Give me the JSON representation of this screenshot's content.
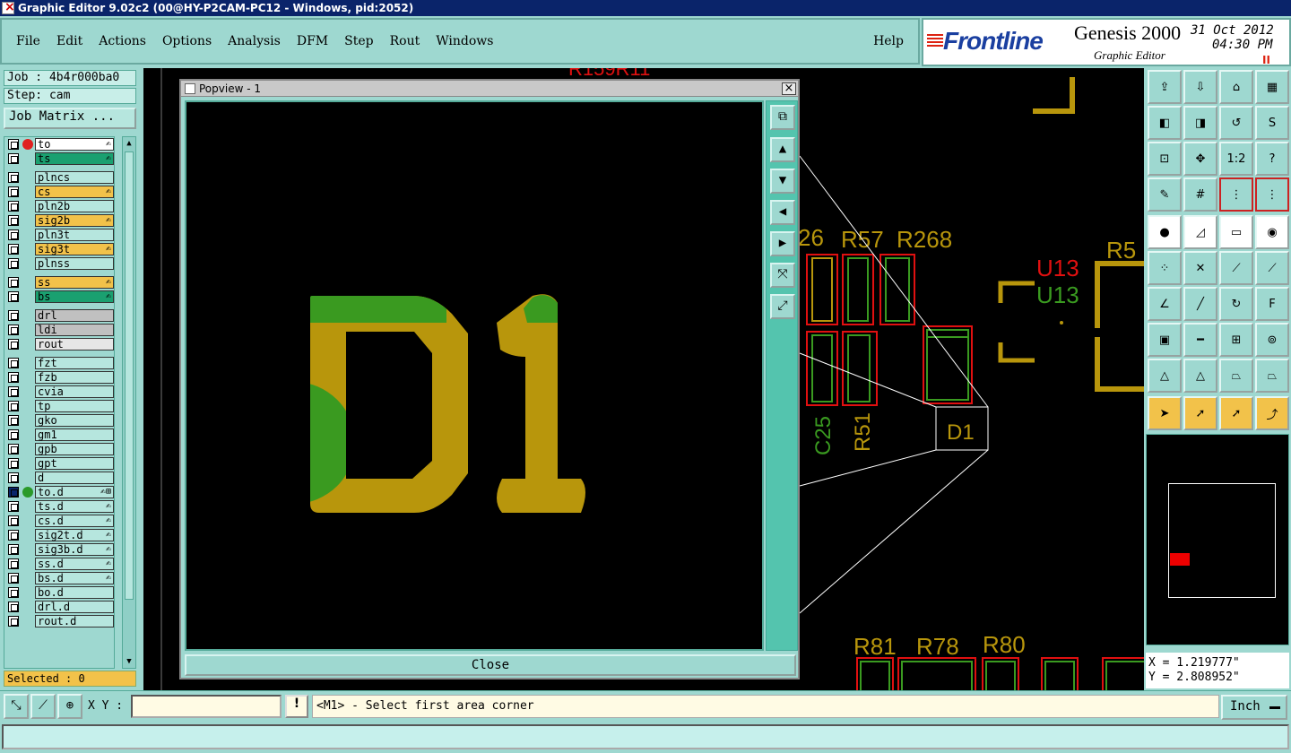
{
  "window": {
    "title": "Graphic Editor 9.02c2 (00@HY-P2CAM-PC12 - Windows, pid:2052)"
  },
  "menu": [
    "File",
    "Edit",
    "Actions",
    "Options",
    "Analysis",
    "DFM",
    "Step",
    "Rout",
    "Windows"
  ],
  "help": "Help",
  "logo": {
    "brand": "Frontline",
    "product": "Genesis 2000",
    "subtitle": "Graphic Editor",
    "date": "31 Oct 2012",
    "time": "04:30 PM",
    "pause": "II"
  },
  "job": {
    "job": "Job : 4b4r000ba0",
    "step": "Step: cam",
    "matrix": "Job Matrix ..."
  },
  "layers": [
    {
      "name": "to",
      "color": "#ffffff",
      "dot": "#e02020",
      "mark": "✍",
      "group": 0
    },
    {
      "name": "ts",
      "color": "#1aa070",
      "mark": "✍",
      "group": 0
    },
    {
      "name": "plncs",
      "color": "#b6e6de",
      "group": 1
    },
    {
      "name": "cs",
      "color": "#f2c24a",
      "mark": "✍",
      "group": 1
    },
    {
      "name": "pln2b",
      "color": "#b6e6de",
      "group": 1
    },
    {
      "name": "sig2b",
      "color": "#f2c24a",
      "mark": "✍",
      "group": 1
    },
    {
      "name": "pln3t",
      "color": "#b6e6de",
      "group": 1
    },
    {
      "name": "sig3t",
      "color": "#f2c24a",
      "mark": "✍",
      "group": 1
    },
    {
      "name": "plnss",
      "color": "#b6e6de",
      "group": 1
    },
    {
      "name": "ss",
      "color": "#f2c24a",
      "mark": "✍",
      "group": 2
    },
    {
      "name": "bs",
      "color": "#1aa070",
      "mark": "✍",
      "group": 2
    },
    {
      "name": "drl",
      "color": "#c0c0c0",
      "group": 3
    },
    {
      "name": "ldi",
      "color": "#c0c0c0",
      "group": 3
    },
    {
      "name": "rout",
      "color": "#e6e6e6",
      "group": 3
    },
    {
      "name": "fzt",
      "color": "#b6e6de",
      "group": 4
    },
    {
      "name": "fzb",
      "color": "#b6e6de",
      "group": 4
    },
    {
      "name": "cvia",
      "color": "#b6e6de",
      "group": 4
    },
    {
      "name": "tp",
      "color": "#b6e6de",
      "group": 4
    },
    {
      "name": "gko",
      "color": "#b6e6de",
      "group": 4
    },
    {
      "name": "gm1",
      "color": "#b6e6de",
      "group": 4
    },
    {
      "name": "gpb",
      "color": "#b6e6de",
      "group": 4
    },
    {
      "name": "gpt",
      "color": "#b6e6de",
      "group": 4
    },
    {
      "name": "d",
      "color": "#b6e6de",
      "group": 4
    },
    {
      "name": "to.d",
      "color": "#b6e6de",
      "dot": "#2a9a2a",
      "mark": "✍⊞",
      "selected": true,
      "group": 4
    },
    {
      "name": "ts.d",
      "color": "#b6e6de",
      "mark": "✍",
      "group": 4
    },
    {
      "name": "cs.d",
      "color": "#b6e6de",
      "mark": "✍",
      "group": 4
    },
    {
      "name": "sig2t.d",
      "color": "#b6e6de",
      "mark": "✍",
      "group": 4
    },
    {
      "name": "sig3b.d",
      "color": "#b6e6de",
      "mark": "✍",
      "group": 4
    },
    {
      "name": "ss.d",
      "color": "#b6e6de",
      "mark": "✍",
      "group": 4
    },
    {
      "name": "bs.d",
      "color": "#b6e6de",
      "mark": "✍",
      "group": 4
    },
    {
      "name": "bo.d",
      "color": "#b6e6de",
      "group": 4
    },
    {
      "name": "drl.d",
      "color": "#b6e6de",
      "group": 4
    },
    {
      "name": "rout.d",
      "color": "#b6e6de",
      "group": 4
    }
  ],
  "selected": "Selected : 0",
  "popview": {
    "title": "Popview - 1",
    "close": "Close",
    "text": "D1"
  },
  "canvas_labels": {
    "top": "R159R11",
    "r26": "26",
    "r57": "R57",
    "r268": "R268",
    "u13red": "U13",
    "u13green": "U13",
    "r5x": "R5",
    "c25": "C25",
    "r51": "R51",
    "d1": "D1",
    "r81": "R81",
    "r78": "R78",
    "r80": "R80"
  },
  "toolbar_labels": {
    "ratio": "1:2",
    "question": "?"
  },
  "coords": {
    "x": "X = 1.219777\"",
    "y": "Y = 2.808952\""
  },
  "bottom": {
    "xy_label": "X Y :",
    "xy_value": "",
    "warn": "!",
    "prompt": "<M1> - Select first area corner",
    "unit": "Inch"
  },
  "colors": {
    "copper": "#b8960c",
    "green": "#3a9a20",
    "red": "#e01010",
    "panel": "#9ed8d0"
  }
}
